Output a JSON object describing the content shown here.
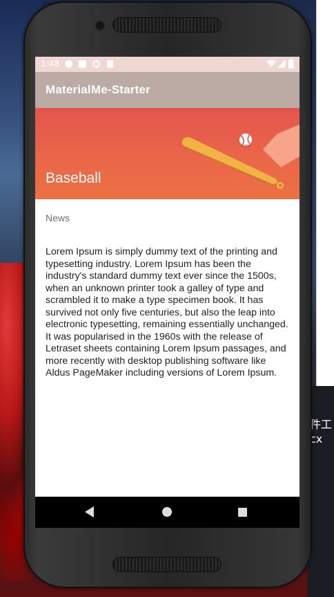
{
  "status_bar": {
    "time": "1:48",
    "icons": [
      "play-icon",
      "notification-icon",
      "sync-icon",
      "sd-card-icon",
      "wifi-icon",
      "signal-icon",
      "battery-icon"
    ]
  },
  "app_bar": {
    "title": "MaterialMe-Starter"
  },
  "detail": {
    "sport_title": "Baseball",
    "subtitle": "News",
    "body": "Lorem Ipsum is simply dummy text of the printing and typesetting industry. Lorem Ipsum has been the industry's standard dummy text ever since the 1500s, when an unknown printer took a galley of type and scrambled it to make a type specimen book. It has survived not only five centuries, but also the leap into electronic typesetting, remaining essentially unchanged. It was popularised in the 1960s with the release of Letraset sheets containing Lorem Ipsum passages, and more recently with desktop publishing software like Aldus PageMaker including versions of Lorem Ipsum."
  },
  "nav_bar": {
    "icons": [
      "back-icon",
      "home-icon",
      "recents-icon"
    ]
  },
  "desktop": {
    "right_text_1": "件工",
    "right_text_2": "cx"
  },
  "colors": {
    "status_bar": "#efd8d3",
    "app_bar": "#bcaaa4",
    "header_top": "#e2554e",
    "header_bottom": "#ec7144",
    "bat": "#f2b245",
    "base": "#f7a48a"
  }
}
